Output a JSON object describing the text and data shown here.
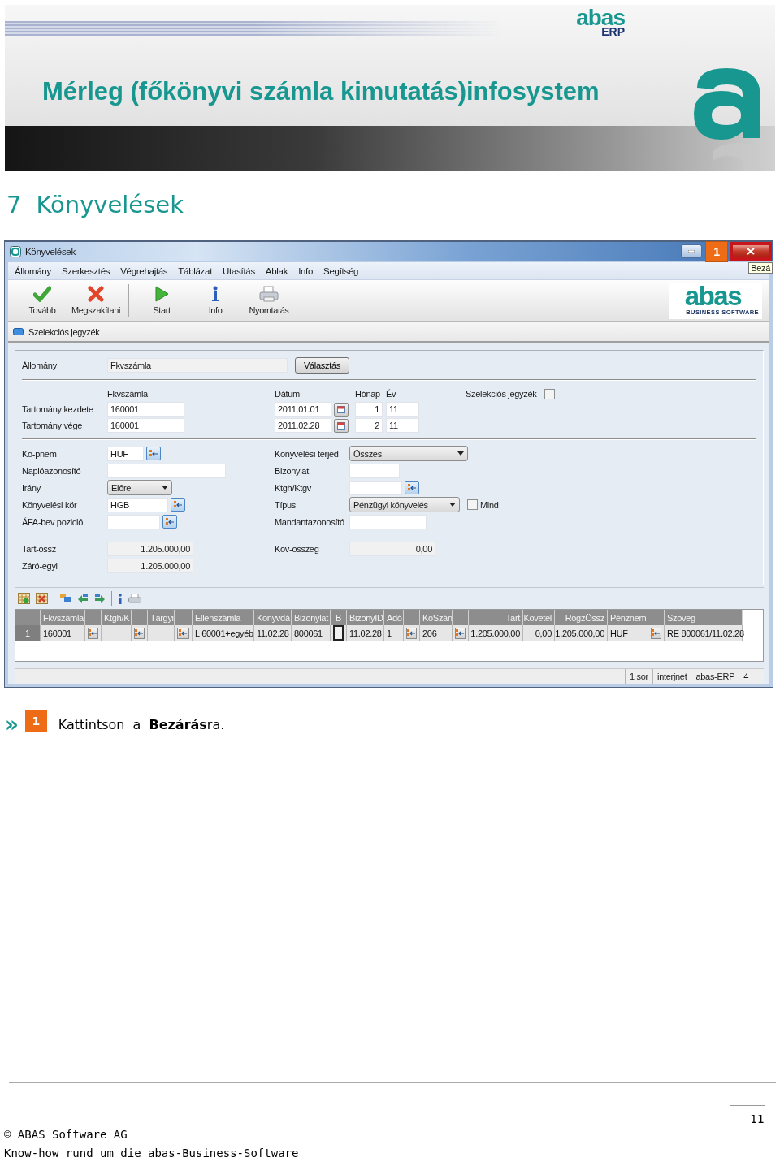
{
  "banner": {
    "title": "Mérleg (főkönyvi számla kimutatás)infosystem",
    "logo": {
      "name": "abas",
      "suffix": "ERP"
    }
  },
  "heading": {
    "number": "7",
    "text": "Könyvelések"
  },
  "window": {
    "title": "Könyvelések",
    "callout": "1",
    "tooltip": "Bezá",
    "menu": [
      "Állomány",
      "Szerkesztés",
      "Végrehajtás",
      "Táblázat",
      "Utasítás",
      "Ablak",
      "Info",
      "Segítség"
    ],
    "toolbar_groups": [
      [
        {
          "label": "Tovább",
          "kind": "confirm"
        },
        {
          "label": "Megszakítani",
          "kind": "cancel"
        }
      ],
      [
        {
          "label": "Start",
          "kind": "start"
        },
        {
          "label": "Info",
          "kind": "info"
        },
        {
          "label": "Nyomtatás",
          "kind": "print"
        }
      ]
    ],
    "brand": {
      "name": "abas",
      "tagline": "BUSINESS SOFTWARE"
    },
    "section": "Szelekciós jegyzék",
    "form": {
      "source": {
        "label": "Állomány",
        "value": "Fkvszámla",
        "button": "Választás"
      },
      "range": {
        "headers": [
          "Fkvszámla",
          "Dátum",
          "Hónap",
          "Év"
        ],
        "selection": {
          "label": "Szelekciós jegyzék",
          "checked": false
        },
        "rows": [
          {
            "label": "Tartomány kezdete",
            "account": "160001",
            "date": "2011.01.01",
            "month": "1",
            "year": "11"
          },
          {
            "label": "Tartomány vége",
            "account": "160001",
            "date": "2011.02.28",
            "month": "2",
            "year": "11"
          }
        ]
      },
      "rows": [
        {
          "left": {
            "label": "Kö-pnem",
            "value": "HUF",
            "kind": "lookup"
          },
          "right": {
            "label": "Könyvelési terjed",
            "value": "Összes",
            "kind": "select"
          }
        },
        {
          "left": {
            "label": "Naplóazonosító",
            "kind": "text"
          },
          "right": {
            "label": "Bizonylat",
            "kind": "text"
          }
        },
        {
          "left": {
            "label": "Irány",
            "value": "Előre",
            "kind": "select"
          },
          "right": {
            "label": "Ktgh/Ktgv",
            "kind": "lookup"
          }
        },
        {
          "left": {
            "label": "Könyvelési kör",
            "value": "HGB",
            "kind": "lookup"
          },
          "right": {
            "label": "Típus",
            "value": "Pénzügyi könyvelés",
            "kind": "select",
            "option": {
              "label": "Mind",
              "checked": false
            }
          }
        },
        {
          "left": {
            "label": "ÁFA-bev pozició",
            "kind": "lookup"
          },
          "right": {
            "label": "Mandantazonosító",
            "kind": "text"
          }
        }
      ],
      "totals": [
        {
          "label": "Tart-össz",
          "value": "1.205.000,00"
        },
        {
          "label": "Záró-egyl",
          "value": "1.205.000,00"
        }
      ],
      "balance": {
        "label": "Köv-összeg",
        "value": "0,00"
      }
    },
    "table": {
      "columns": [
        {
          "label": "Fkvszámla",
          "kind": "text"
        },
        {
          "kind": "lookup"
        },
        {
          "label": "Ktgh/K",
          "kind": "text"
        },
        {
          "kind": "lookup"
        },
        {
          "label": "Tárgyi",
          "kind": "text"
        },
        {
          "kind": "lookup"
        },
        {
          "label": "Ellenszámla",
          "kind": "text"
        },
        {
          "label": "Könyvdá",
          "kind": "text"
        },
        {
          "label": "Bizonylat",
          "kind": "text"
        },
        {
          "label": "B",
          "kind": "check"
        },
        {
          "label": "BizonyID",
          "kind": "text"
        },
        {
          "label": "Adó",
          "kind": "text"
        },
        {
          "kind": "lookup"
        },
        {
          "label": "KöSzán",
          "kind": "text"
        },
        {
          "kind": "lookup"
        },
        {
          "label": "Tart",
          "kind": "number"
        },
        {
          "label": "Követel",
          "kind": "number"
        },
        {
          "label": "RögzÖssz",
          "kind": "number"
        },
        {
          "label": "Pénznem",
          "kind": "text"
        },
        {
          "kind": "lookup"
        },
        {
          "label": "Szöveg",
          "kind": "text"
        }
      ],
      "rows": [
        {
          "number": "1",
          "cells": [
            {
              "value": "160001"
            },
            {},
            {},
            {},
            {},
            {},
            {
              "value": "L 60001+egyéb"
            },
            {
              "value": "11.02.28"
            },
            {
              "value": "800061"
            },
            {
              "checked": false
            },
            {
              "value": "11.02.28"
            },
            {
              "value": "1"
            },
            {},
            {
              "value": "206"
            },
            {},
            {
              "value": "1.205.000,00"
            },
            {
              "value": "0,00"
            },
            {
              "value": "1.205.000,00"
            },
            {
              "value": "HUF"
            },
            {},
            {
              "value": "RE 800061/11.02.28"
            }
          ]
        }
      ]
    },
    "status_bar": [
      "1 sor",
      "interjnet",
      "abas-ERP",
      "4"
    ]
  },
  "instruction": {
    "marker": "»",
    "step": "1",
    "text": "Kattintson a **Bezárás**ra."
  },
  "footer": {
    "page_number": "11",
    "copyright": "© ABAS Software AG",
    "tagline": "Know-how rund um die abas-Business-Software"
  }
}
